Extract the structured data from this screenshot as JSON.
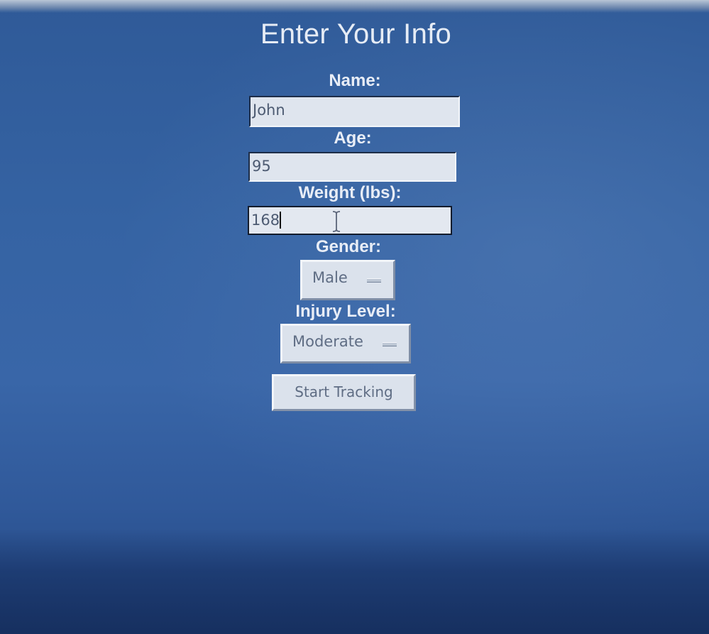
{
  "form": {
    "title": "Enter Your Info",
    "name": {
      "label": "Name:",
      "value": "John"
    },
    "age": {
      "label": "Age:",
      "value": "95"
    },
    "weight": {
      "label": "Weight (lbs):",
      "value": "168"
    },
    "gender": {
      "label": "Gender:",
      "selected": "Male"
    },
    "injury_level": {
      "label": "Injury Level:",
      "selected": "Moderate"
    },
    "start_button": "Start Tracking"
  },
  "colors": {
    "background": "#3563a3",
    "field_background": "#dfe5ee",
    "label_text": "#e8edf6"
  }
}
